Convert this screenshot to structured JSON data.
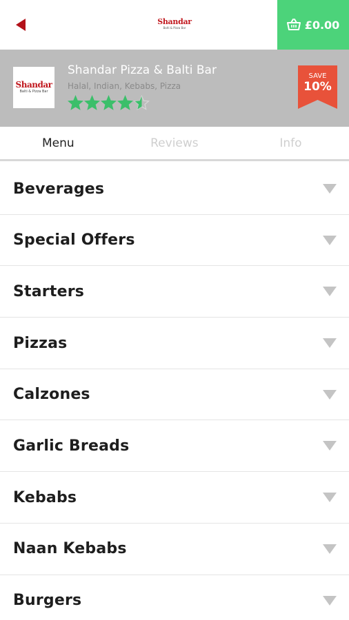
{
  "header": {
    "back_icon": "back-arrow-icon",
    "logo": {
      "main": "Shandar",
      "sub": "Balti & Pizza Bar"
    },
    "cart": {
      "icon": "basket-icon",
      "total": "£0.00",
      "color": "#4cd37a"
    }
  },
  "restaurant": {
    "logo": {
      "main": "Shandar",
      "sub": "Balti & Pizza Bar"
    },
    "name": "Shandar Pizza & Balti Bar",
    "cuisine": "Halal, Indian, Kebabs, Pizza",
    "rating": 4.5,
    "rating_max": 5,
    "rating_color": "#3bbf6a",
    "badge": {
      "label": "SAVE",
      "value": "10%",
      "color": "#e8523a"
    }
  },
  "tabs": [
    {
      "label": "Menu",
      "active": true
    },
    {
      "label": "Reviews",
      "active": false
    },
    {
      "label": "Info",
      "active": false
    }
  ],
  "menu": {
    "expand_icon": "chevron-down-icon",
    "items": [
      {
        "label": "Beverages"
      },
      {
        "label": "Special Offers"
      },
      {
        "label": "Starters"
      },
      {
        "label": "Pizzas"
      },
      {
        "label": "Calzones"
      },
      {
        "label": "Garlic Breads"
      },
      {
        "label": "Kebabs"
      },
      {
        "label": "Naan Kebabs"
      },
      {
        "label": "Burgers"
      }
    ]
  }
}
